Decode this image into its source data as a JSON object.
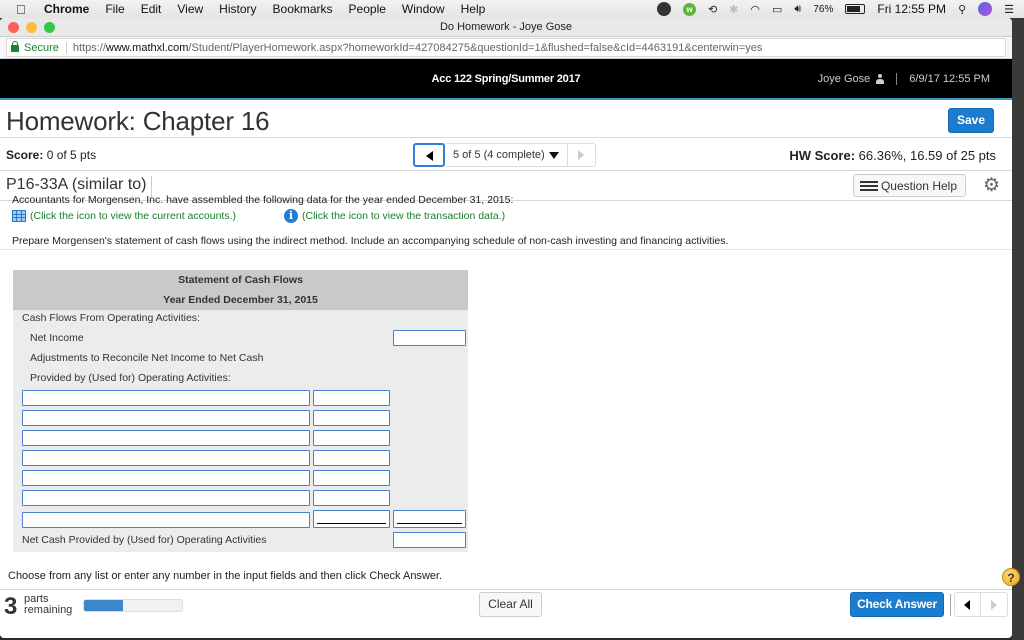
{
  "menubar": {
    "app": "Chrome",
    "items": [
      "File",
      "Edit",
      "View",
      "History",
      "Bookmarks",
      "People",
      "Window",
      "Help"
    ],
    "battery": "76%",
    "clock": "Fri 12:55 PM"
  },
  "browser": {
    "window_title": "Do Homework - Joye Gose",
    "secure_label": "Secure",
    "url_scheme": "https://",
    "url_host": "www.mathxl.com",
    "url_rest": "/Student/PlayerHomework.aspx?homeworkId=427084275&questionId=1&flushed=false&cId=4463191&centerwin=yes"
  },
  "header": {
    "course": "Acc 122 Spring/Summer 2017",
    "user": "Joye Gose",
    "datetime": "6/9/17 12:55 PM"
  },
  "page": {
    "title": "Homework: Chapter 16",
    "save_label": "Save",
    "score_label": "Score:",
    "score_value": "0 of 5 pts",
    "question_nav": "5 of 5 (4 complete)",
    "hw_score_label": "HW Score:",
    "hw_score_value": "66.36%, 16.59 of 25 pts",
    "question_id": "P16-33A (similar to)",
    "question_help_label": "Question Help"
  },
  "question": {
    "intro": "Accountants for Morgensen, Inc. have assembled the following data for the year ended December 31, 2015:",
    "link_accounts": "(Click the icon to view the current accounts.)",
    "link_transactions": "(Click the icon to view the transaction data.)",
    "prepare": "Prepare Morgensen's statement of cash flows using the indirect method. Include an accompanying schedule of non-cash investing and financing activities."
  },
  "statement": {
    "title": "Statement of Cash Flows",
    "period": "Year Ended December 31, 2015",
    "section_operating": "Cash Flows From Operating Activities:",
    "net_income": "Net Income",
    "adjustments_line1": "Adjustments to Reconcile Net Income to Net Cash",
    "adjustments_line2": "Provided by (Used for) Operating Activities:",
    "net_cash_operating": "Net Cash Provided by (Used for) Operating Activities",
    "adjustment_rows": [
      {
        "label": "",
        "amount": ""
      },
      {
        "label": "",
        "amount": ""
      },
      {
        "label": "",
        "amount": ""
      },
      {
        "label": "",
        "amount": ""
      },
      {
        "label": "",
        "amount": ""
      },
      {
        "label": "",
        "amount": ""
      },
      {
        "label": "",
        "amount": ""
      }
    ],
    "net_income_value": "",
    "total_adjustments_value": "",
    "net_cash_value": ""
  },
  "footer": {
    "instructions": "Choose from any list or enter any number in the input fields and then click Check Answer.",
    "parts_remaining": "3",
    "parts_label_1": "parts",
    "parts_label_2": "remaining",
    "progress_fraction": 0.4,
    "clear_all_label": "Clear All",
    "check_answer_label": "Check Answer"
  },
  "colors": {
    "primary_button": "#1b7dd0",
    "link_green": "#177f2a",
    "header_bg": "#000000",
    "accent_line": "#3b96c4",
    "input_border": "#4a7fd0"
  }
}
